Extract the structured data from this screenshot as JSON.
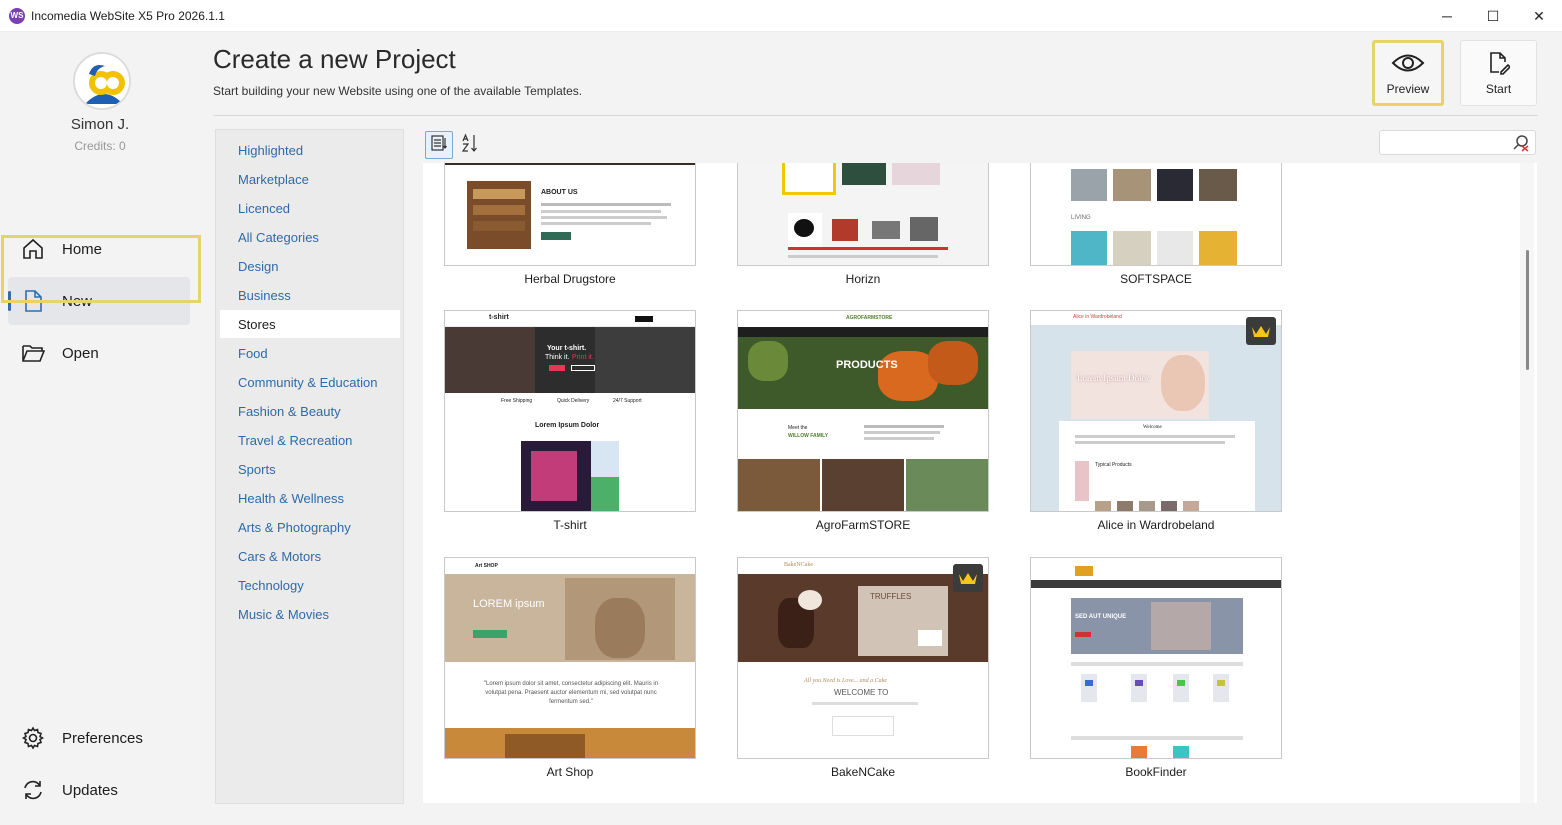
{
  "window": {
    "logo_text": "WS",
    "title": "Incomedia WebSite X5 Pro 2026.1.1",
    "minimize": "─",
    "maximize": "☐",
    "close": "✕"
  },
  "user": {
    "name": "Simon J.",
    "credits": "Credits: 0"
  },
  "nav": {
    "home": "Home",
    "new": "New",
    "open": "Open",
    "preferences": "Preferences",
    "updates": "Updates"
  },
  "header": {
    "title": "Create a new Project",
    "subtitle": "Start building your new Website using one of the available Templates.",
    "preview_label": "Preview",
    "start_label": "Start"
  },
  "categories": [
    "Highlighted",
    "Marketplace",
    "Licenced",
    "All Categories",
    "Design",
    "Business",
    "Stores",
    "Food",
    "Community & Education",
    "Fashion & Beauty",
    "Travel & Recreation",
    "Sports",
    "Health & Wellness",
    "Arts & Photography",
    "Cars & Motors",
    "Technology",
    "Music & Movies"
  ],
  "selected_category": "Stores",
  "search": {
    "value": "",
    "placeholder": ""
  },
  "templates": [
    {
      "name": "Herbal Drugstore",
      "premium": false
    },
    {
      "name": "Horizn",
      "premium": false
    },
    {
      "name": "SOFTSPACE",
      "premium": false
    },
    {
      "name": "T-shirt",
      "premium": false
    },
    {
      "name": "AgroFarmSTORE",
      "premium": false
    },
    {
      "name": "Alice in Wardrobeland",
      "premium": true
    },
    {
      "name": "Art Shop",
      "premium": false
    },
    {
      "name": "BakeNCake",
      "premium": true
    },
    {
      "name": "BookFinder",
      "premium": false
    }
  ],
  "thumb_text": {
    "herbal_heading": "ABOUT US",
    "tshirt_brand": "t-shirt",
    "tshirt_hero1": "Your t-shirt.",
    "tshirt_hero2": "Think it.",
    "tshirt_hero3": "Print it.",
    "tshirt_f1": "Free Shipping",
    "tshirt_f2": "Quick Delivery",
    "tshirt_f3": "24/7 Support",
    "tshirt_lorem": "Lorem Ipsum Dolor",
    "agro_brand": "AGROFARMSTORE",
    "agro_hero": "PRODUCTS",
    "agro_meet": "Meet the",
    "agro_family": "WILLOW FAMILY",
    "alice_brand": "Alice in Wardrobeland",
    "alice_hero": "Lorem Ipsum Dolor",
    "alice_welcome": "Welcome",
    "alice_products": "Typical Products",
    "art_brand": "Art SHOP",
    "art_hero": "LOREM ipsum",
    "art_quote": "\"Lorem ipsum dolor sit amet, consectetur adipiscing elit. Mauris in volutpat pena. Praesent auctor elementum mi, sed volutpat nunc fermentum sed.\"",
    "bake_brand": "BakeNCake",
    "bake_hero": "TRUFFLES",
    "bake_script": "All you Need is Love... and a Cake",
    "bake_welcome": "WELCOME TO",
    "book_hero": "SED AUT UNIQUE",
    "softspace_label": "LIVING"
  },
  "colors": {
    "accent": "#2f6aa8",
    "highlight": "#e8d36a",
    "tshirt_red": "#e03a55",
    "agro_green": "#4f7f2e"
  }
}
